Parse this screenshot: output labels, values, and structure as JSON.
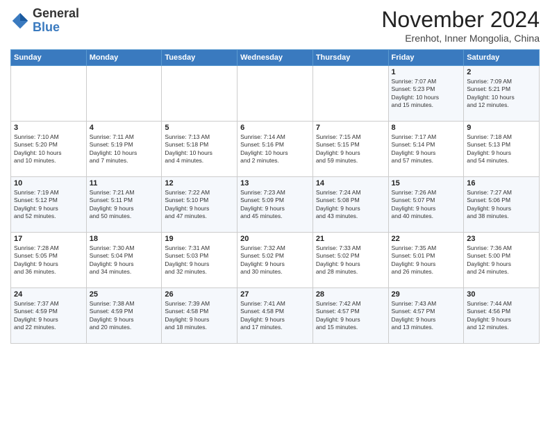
{
  "logo": {
    "general": "General",
    "blue": "Blue"
  },
  "title": "November 2024",
  "location": "Erenhot, Inner Mongolia, China",
  "days_header": [
    "Sunday",
    "Monday",
    "Tuesday",
    "Wednesday",
    "Thursday",
    "Friday",
    "Saturday"
  ],
  "weeks": [
    [
      {
        "day": "",
        "info": ""
      },
      {
        "day": "",
        "info": ""
      },
      {
        "day": "",
        "info": ""
      },
      {
        "day": "",
        "info": ""
      },
      {
        "day": "",
        "info": ""
      },
      {
        "day": "1",
        "info": "Sunrise: 7:07 AM\nSunset: 5:23 PM\nDaylight: 10 hours\nand 15 minutes."
      },
      {
        "day": "2",
        "info": "Sunrise: 7:09 AM\nSunset: 5:21 PM\nDaylight: 10 hours\nand 12 minutes."
      }
    ],
    [
      {
        "day": "3",
        "info": "Sunrise: 7:10 AM\nSunset: 5:20 PM\nDaylight: 10 hours\nand 10 minutes."
      },
      {
        "day": "4",
        "info": "Sunrise: 7:11 AM\nSunset: 5:19 PM\nDaylight: 10 hours\nand 7 minutes."
      },
      {
        "day": "5",
        "info": "Sunrise: 7:13 AM\nSunset: 5:18 PM\nDaylight: 10 hours\nand 4 minutes."
      },
      {
        "day": "6",
        "info": "Sunrise: 7:14 AM\nSunset: 5:16 PM\nDaylight: 10 hours\nand 2 minutes."
      },
      {
        "day": "7",
        "info": "Sunrise: 7:15 AM\nSunset: 5:15 PM\nDaylight: 9 hours\nand 59 minutes."
      },
      {
        "day": "8",
        "info": "Sunrise: 7:17 AM\nSunset: 5:14 PM\nDaylight: 9 hours\nand 57 minutes."
      },
      {
        "day": "9",
        "info": "Sunrise: 7:18 AM\nSunset: 5:13 PM\nDaylight: 9 hours\nand 54 minutes."
      }
    ],
    [
      {
        "day": "10",
        "info": "Sunrise: 7:19 AM\nSunset: 5:12 PM\nDaylight: 9 hours\nand 52 minutes."
      },
      {
        "day": "11",
        "info": "Sunrise: 7:21 AM\nSunset: 5:11 PM\nDaylight: 9 hours\nand 50 minutes."
      },
      {
        "day": "12",
        "info": "Sunrise: 7:22 AM\nSunset: 5:10 PM\nDaylight: 9 hours\nand 47 minutes."
      },
      {
        "day": "13",
        "info": "Sunrise: 7:23 AM\nSunset: 5:09 PM\nDaylight: 9 hours\nand 45 minutes."
      },
      {
        "day": "14",
        "info": "Sunrise: 7:24 AM\nSunset: 5:08 PM\nDaylight: 9 hours\nand 43 minutes."
      },
      {
        "day": "15",
        "info": "Sunrise: 7:26 AM\nSunset: 5:07 PM\nDaylight: 9 hours\nand 40 minutes."
      },
      {
        "day": "16",
        "info": "Sunrise: 7:27 AM\nSunset: 5:06 PM\nDaylight: 9 hours\nand 38 minutes."
      }
    ],
    [
      {
        "day": "17",
        "info": "Sunrise: 7:28 AM\nSunset: 5:05 PM\nDaylight: 9 hours\nand 36 minutes."
      },
      {
        "day": "18",
        "info": "Sunrise: 7:30 AM\nSunset: 5:04 PM\nDaylight: 9 hours\nand 34 minutes."
      },
      {
        "day": "19",
        "info": "Sunrise: 7:31 AM\nSunset: 5:03 PM\nDaylight: 9 hours\nand 32 minutes."
      },
      {
        "day": "20",
        "info": "Sunrise: 7:32 AM\nSunset: 5:02 PM\nDaylight: 9 hours\nand 30 minutes."
      },
      {
        "day": "21",
        "info": "Sunrise: 7:33 AM\nSunset: 5:02 PM\nDaylight: 9 hours\nand 28 minutes."
      },
      {
        "day": "22",
        "info": "Sunrise: 7:35 AM\nSunset: 5:01 PM\nDaylight: 9 hours\nand 26 minutes."
      },
      {
        "day": "23",
        "info": "Sunrise: 7:36 AM\nSunset: 5:00 PM\nDaylight: 9 hours\nand 24 minutes."
      }
    ],
    [
      {
        "day": "24",
        "info": "Sunrise: 7:37 AM\nSunset: 4:59 PM\nDaylight: 9 hours\nand 22 minutes."
      },
      {
        "day": "25",
        "info": "Sunrise: 7:38 AM\nSunset: 4:59 PM\nDaylight: 9 hours\nand 20 minutes."
      },
      {
        "day": "26",
        "info": "Sunrise: 7:39 AM\nSunset: 4:58 PM\nDaylight: 9 hours\nand 18 minutes."
      },
      {
        "day": "27",
        "info": "Sunrise: 7:41 AM\nSunset: 4:58 PM\nDaylight: 9 hours\nand 17 minutes."
      },
      {
        "day": "28",
        "info": "Sunrise: 7:42 AM\nSunset: 4:57 PM\nDaylight: 9 hours\nand 15 minutes."
      },
      {
        "day": "29",
        "info": "Sunrise: 7:43 AM\nSunset: 4:57 PM\nDaylight: 9 hours\nand 13 minutes."
      },
      {
        "day": "30",
        "info": "Sunrise: 7:44 AM\nSunset: 4:56 PM\nDaylight: 9 hours\nand 12 minutes."
      }
    ]
  ]
}
